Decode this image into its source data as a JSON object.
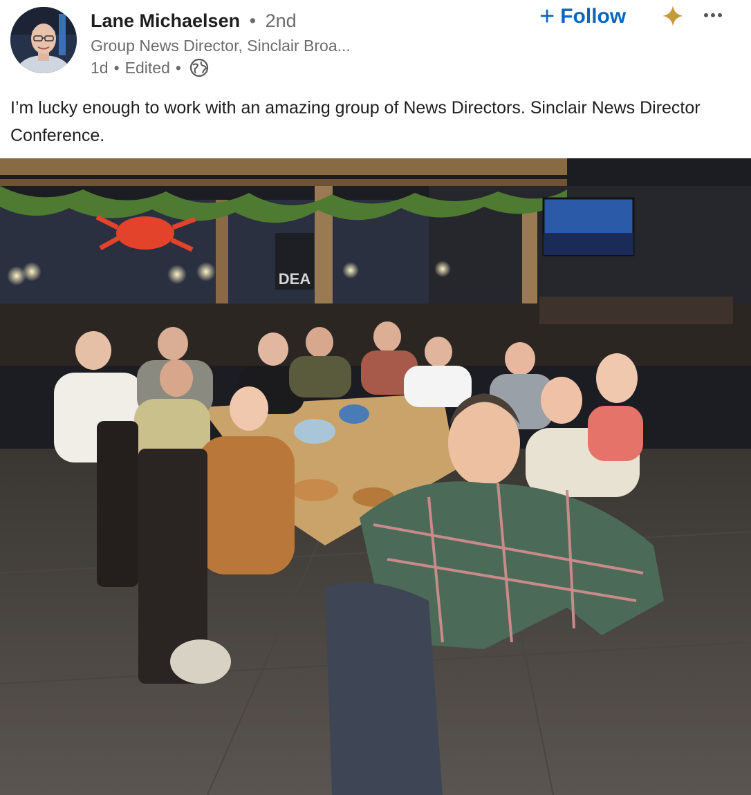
{
  "author": {
    "name": "Lane Michaelsen",
    "separator": "•",
    "degree": "2nd",
    "headline": "Group News Director, Sinclair Broa...",
    "time": "1d",
    "edited": "Edited",
    "meta_separator": "•",
    "visibility_icon": "globe-icon"
  },
  "actions": {
    "follow_plus": "+",
    "follow_label": "Follow",
    "ai_icon": "sparkle-icon",
    "more_icon": "more-options-icon"
  },
  "post": {
    "text": "I’m lucky enough to work with an amazing group of News Directors. Sinclair News Director Conference."
  },
  "photo": {
    "sign_text": "DEA",
    "colors": {
      "accent": "#0a66c2",
      "sparkle": "#c49a3c"
    }
  }
}
